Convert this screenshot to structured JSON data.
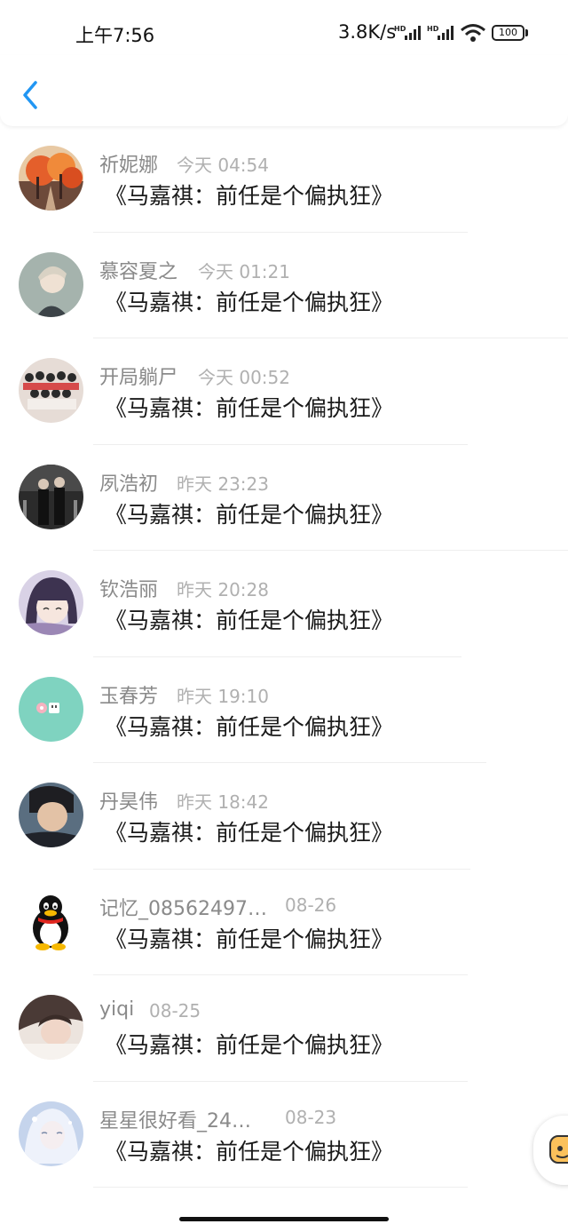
{
  "status_bar": {
    "time": "上午7:56",
    "network_speed": "3.8K/s",
    "battery": "100",
    "icons": [
      "hd-signal-icon",
      "hd-signal-icon",
      "wifi-icon",
      "battery-icon"
    ]
  },
  "header": {
    "back_icon": "chevron-left-icon",
    "accent": "#2196F3"
  },
  "messages": [
    {
      "name": "祈妮娜",
      "time": "今天 04:54",
      "text": "《马嘉祺：前任是个偏执狂》"
    },
    {
      "name": "慕容夏之",
      "time": "今天 01:21",
      "text": "《马嘉祺：前任是个偏执狂》"
    },
    {
      "name": "开局躺尸",
      "time": "今天 00:52",
      "text": "《马嘉祺：前任是个偏执狂》"
    },
    {
      "name": "夙浩初",
      "time": "昨天 23:23",
      "text": "《马嘉祺：前任是个偏执狂》"
    },
    {
      "name": "钦浩丽",
      "time": "昨天 20:28",
      "text": "《马嘉祺：前任是个偏执狂》"
    },
    {
      "name": "玉春芳",
      "time": "昨天 19:10",
      "text": "《马嘉祺：前任是个偏执狂》"
    },
    {
      "name": "丹昊伟",
      "time": "昨天 18:42",
      "text": "《马嘉祺：前任是个偏执狂》"
    },
    {
      "name": "记忆_08562497…",
      "time": "08-26",
      "text": "《马嘉祺：前任是个偏执狂》"
    },
    {
      "name": "yiqi",
      "time": "08-25",
      "text": "《马嘉祺：前任是个偏执狂》"
    },
    {
      "name": "星星很好看_24…",
      "time": "08-23",
      "text": "《马嘉祺：前任是个偏执狂》"
    }
  ]
}
